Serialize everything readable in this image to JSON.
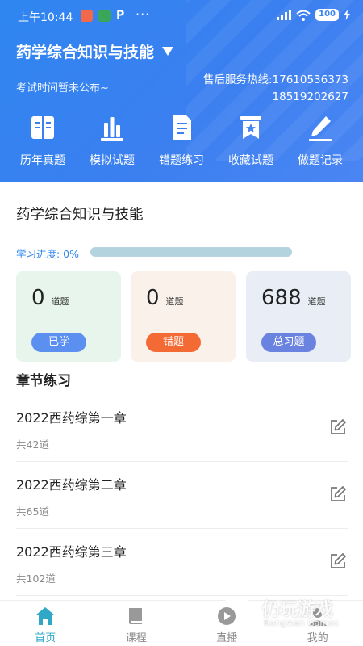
{
  "status_bar": {
    "time": "上午10:44",
    "battery": "100",
    "dots": "···"
  },
  "header": {
    "subject": "药学综合知识与技能",
    "exam_time": "考试时间暂未公布~",
    "hotline_label": "售后服务热线:17610536373",
    "hotline_second": "18519202627"
  },
  "quick_actions": [
    {
      "label": "历年真题",
      "icon": "book-icon"
    },
    {
      "label": "模拟试题",
      "icon": "chart-icon"
    },
    {
      "label": "错题练习",
      "icon": "document-icon"
    },
    {
      "label": "收藏试题",
      "icon": "bookmark-star-icon"
    },
    {
      "label": "做题记录",
      "icon": "pen-icon"
    }
  ],
  "course": {
    "title": "药学综合知识与技能",
    "progress_label": "学习进度: 0%",
    "progress_fraction": 0
  },
  "stats": [
    {
      "value": "0",
      "unit": "道题",
      "label": "已学",
      "bg": "#e7f5ec",
      "pill": "#5b8ff0"
    },
    {
      "value": "0",
      "unit": "道题",
      "label": "错题",
      "bg": "#f9f1ea",
      "pill": "#f36a35"
    },
    {
      "value": "688",
      "unit": "道题",
      "label": "总习题",
      "bg": "#e9eef6",
      "pill": "#6b83e0"
    }
  ],
  "section_title": "章节练习",
  "chapters": [
    {
      "name": "2022西药综第一章",
      "count": "共42道"
    },
    {
      "name": "2022西药综第二章",
      "count": "共65道"
    },
    {
      "name": "2022西药综第三章",
      "count": "共102道"
    }
  ],
  "tabs": [
    {
      "label": "首页",
      "active": true
    },
    {
      "label": "课程",
      "active": false
    },
    {
      "label": "直播",
      "active": false
    },
    {
      "label": "我的",
      "active": false
    }
  ],
  "watermark": {
    "main": "仍玩游戏",
    "sub": "Rengwan Games"
  },
  "colors": {
    "primary": "#2f86f0",
    "accent_tab": "#2fa8c8"
  }
}
